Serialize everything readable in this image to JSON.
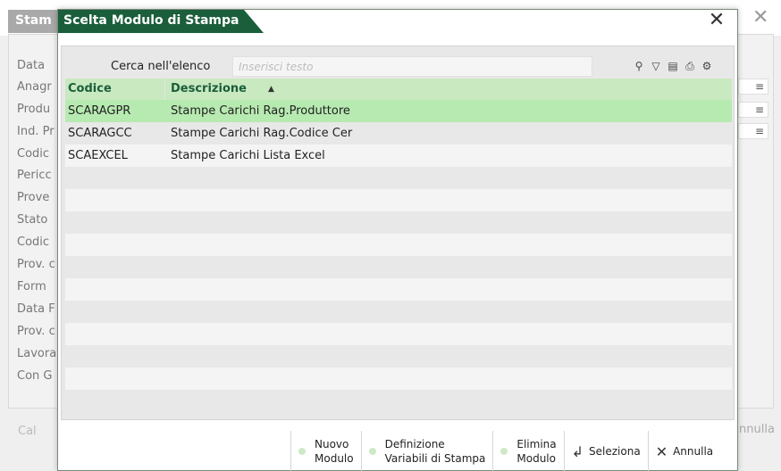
{
  "background": {
    "title": "Stam",
    "labels": [
      "Data",
      "Anagr",
      "Produ",
      "Ind. Pr",
      "Codic",
      "Pericc",
      "Prove",
      "Stato",
      "Codic",
      "Prov. c",
      "Form",
      "Data F",
      "Prov. c",
      "Lavora",
      "Con G"
    ],
    "fields": [
      "≡",
      "≡",
      "≡"
    ],
    "bottom_left": "Cal",
    "bottom_right": "nnulla"
  },
  "dialog": {
    "title": "Scelta Modulo di Stampa",
    "search_label": "Cerca nell'elenco",
    "search_placeholder": "Inserisci testo",
    "columns": {
      "code": "Codice",
      "desc": "Descrizione",
      "sort": "▲"
    },
    "rows": [
      {
        "code": "SCARAGPR",
        "desc": "Stampe Carichi Rag.Produttore"
      },
      {
        "code": "SCARAGCC",
        "desc": "Stampe Carichi Rag.Codice Cer"
      },
      {
        "code": "SCAEXCEL",
        "desc": "Stampe Carichi Lista Excel"
      }
    ],
    "footer": {
      "nuovo": "Nuovo\nModulo",
      "definizione": "Definizione\nVariabili di Stampa",
      "elimina": "Elimina\nModulo",
      "seleziona": "Seleziona",
      "annulla": "Annulla"
    }
  },
  "icons": {
    "close": "✕",
    "search": "⚲",
    "filter": "▽",
    "export": "▤",
    "print": "⎙",
    "settings": "⚙",
    "select": "↲",
    "cancel": "✕"
  },
  "colors": {
    "title_bg": "#1b5e3b",
    "header_bg": "#c9e9c0",
    "selected_row": "#b7eab1"
  }
}
